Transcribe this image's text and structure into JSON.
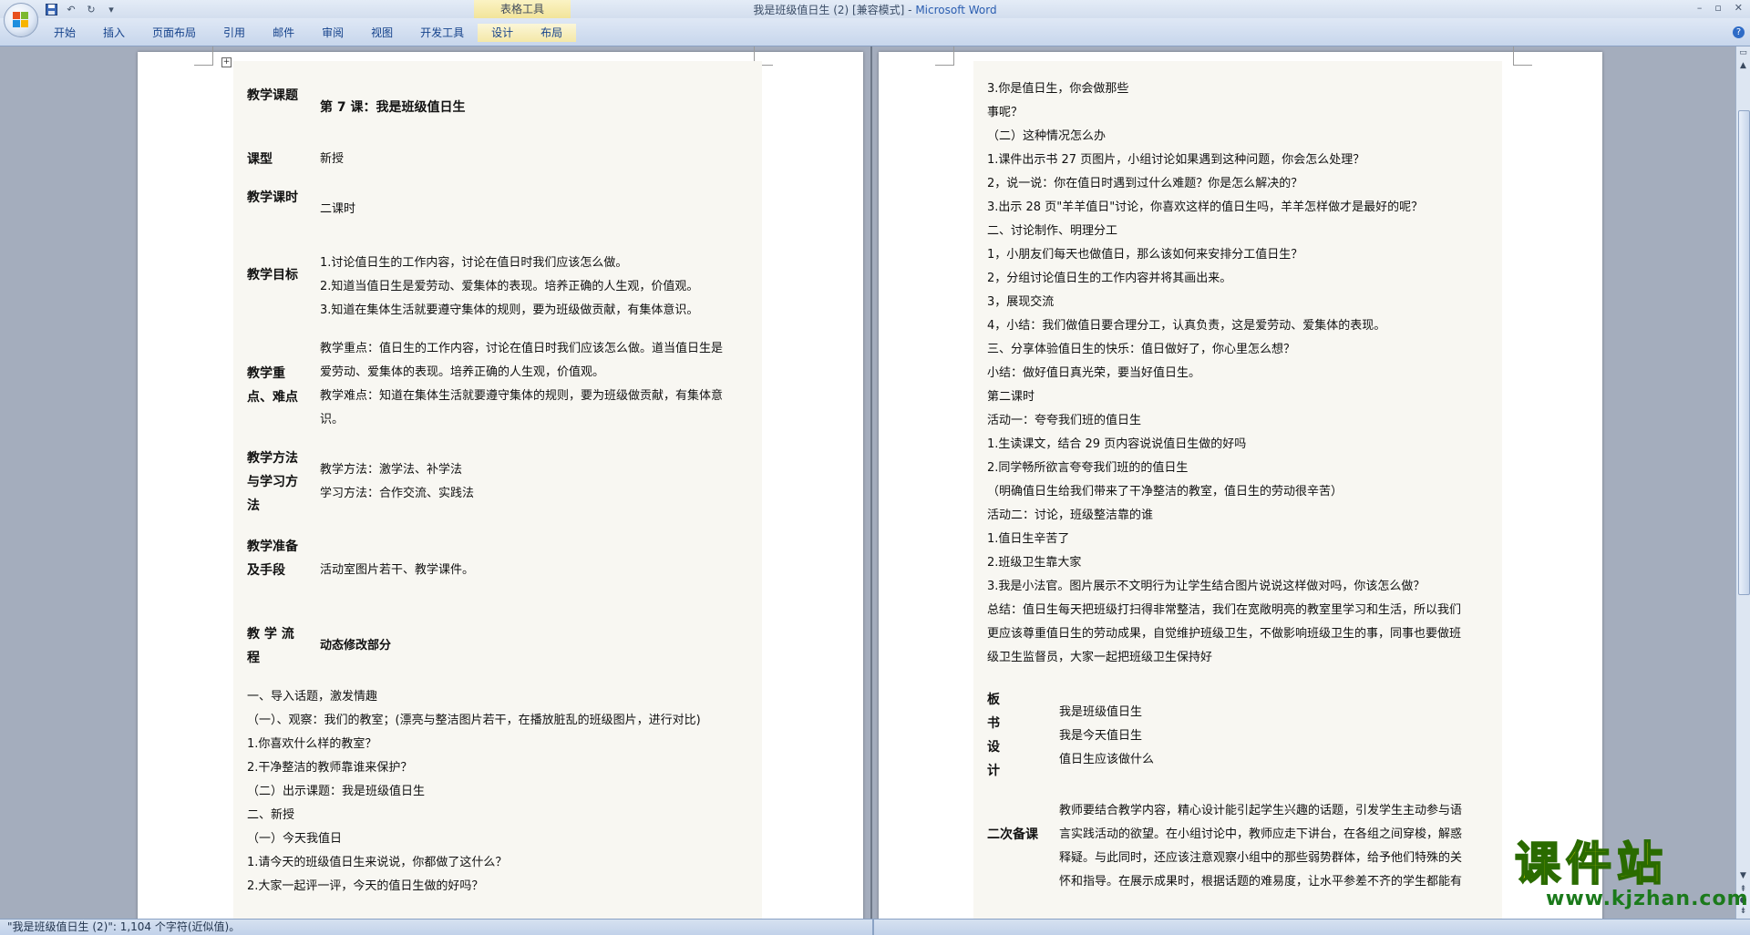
{
  "window": {
    "title": "我是班级值日生 (2) [兼容模式] - ",
    "app": "Microsoft Word",
    "context_tools": "表格工具"
  },
  "ribbon": {
    "tabs": [
      "开始",
      "插入",
      "页面布局",
      "引用",
      "邮件",
      "审阅",
      "视图",
      "开发工具",
      "设计",
      "布局"
    ]
  },
  "left_page": {
    "table": [
      {
        "label": "教学课题",
        "content": [
          "第 7 课：我是班级值日生"
        ],
        "bold": true
      },
      {
        "label": "课型",
        "content": [
          "新授"
        ]
      },
      {
        "label": "教学课时",
        "content": [
          "二课时"
        ]
      },
      {
        "label": "教学目标",
        "content": [
          "1.讨论值日生的工作内容，讨论在值日时我们应该怎么做。",
          "2.知道当值日生是爱劳动、爱集体的表现。培养正确的人生观，价值观。",
          "3.知道在集体生活就要遵守集体的规则，要为班级做贡献，有集体意识。"
        ]
      },
      {
        "label": "教学重点、难点",
        "content": [
          "教学重点：值日生的工作内容，讨论在值日时我们应该怎么做。道当值日生是",
          "爱劳动、爱集体的表现。培养正确的人生观，价值观。",
          "教学难点：知道在集体生活就要遵守集体的规则，要为班级做贡献，有集体意",
          "识。"
        ]
      },
      {
        "label": "教学方法与学习方法",
        "content": [
          "教学方法：激学法、补学法",
          "学习方法：合作交流、实践法"
        ]
      },
      {
        "label": "教学准备及手段",
        "content": [
          "活动室图片若干、教学课件。"
        ]
      },
      {
        "label": "教 学 流 程",
        "content": [
          "动态修改部分"
        ],
        "bold": true
      }
    ],
    "body": [
      "一、导入话题，激发情趣",
      "（一）、观察：我们的教室；(漂亮与整洁图片若干，在播放脏乱的班级图片，进行对比)",
      "1.你喜欢什么样的教室？",
      "2.干净整洁的教师靠谁来保护？",
      "（二）出示课题：我是班级值日生",
      "二、新授",
      "（一）今天我值日",
      "1.请今天的班级值日生来说说，你都做了这什么？",
      "2.大家一起评一评，今天的值日生做的好吗？"
    ]
  },
  "right_page": {
    "body": [
      "3.你是值日生，你会做那些",
      "事呢？",
      "（二）这种情况怎么办",
      "1.课件出示书 27 页图片，小组讨论如果遇到这种问题，你会怎么处理？",
      "2，说一说：你在值日时遇到过什么难题？你是怎么解决的？",
      "3.出示 28 页\"羊羊值日\"讨论，你喜欢这样的值日生吗，羊羊怎样做才是最好的呢？",
      "二、讨论制作、明理分工",
      "1，小朋友们每天也做值日，那么该如何来安排分工值日生？",
      "2，分组讨论值日生的工作内容并将其画出来。",
      "3，展现交流",
      "4，小结：我们做值日要合理分工，认真负责，这是爱劳动、爱集体的表现。",
      "三、分享体验值日生的快乐：值日做好了，你心里怎么想？",
      "小结：做好值日真光荣，要当好值日生。",
      "第二课时",
      "活动一：夸夸我们班的值日生",
      "1.生读课文，结合 29 页内容说说值日生做的好吗",
      "2.同学畅所欲言夸夸我们班的的值日生",
      "（明确值日生给我们带来了干净整洁的教室，值日生的劳动很辛苦）",
      "活动二：讨论，班级整洁靠的谁",
      "1.值日生辛苦了",
      "2.班级卫生靠大家",
      "3.我是小法官。图片展示不文明行为让学生结合图片说说这样做对吗，你该怎么做？",
      "总结：值日生每天把班级打扫得非常整洁，我们在宽敞明亮的教室里学习和生活，所以我们",
      "更应该尊重值日生的劳动成果，自觉维护班级卫生，不做影响班级卫生的事，同事也要做班",
      "级卫生监督员，大家一起把班级卫生保持好"
    ],
    "board_label": [
      "板",
      "书",
      "设",
      "计"
    ],
    "board_lines": [
      "我是班级值日生",
      "我是今天值日生",
      "值日生应该做什么"
    ],
    "prep2_label": "二次备课",
    "prep2_text": [
      "教师要结合教学内容，精心设计能引起学生兴趣的话题，引发学生主动参与语",
      "言实践活动的欲望。在小组讨论中，教师应走下讲台，在各组之间穿梭，解惑",
      "释疑。与此同时，还应该注意观察小组中的那些弱势群体，给予他们特殊的关",
      "怀和指导。在展示成果时，根据话题的难易度，让水平参差不齐的学生都能有"
    ]
  },
  "watermark": {
    "cn": "课件站",
    "url": "www.kjzhan.com"
  },
  "status": {
    "text": "\"我是班级值日生 (2)\": 1,104 个字符(近似值)。"
  },
  "colors": {
    "accent": "#15428b",
    "ribbon": "#c7d6ec",
    "shade": "#f8f7f2"
  }
}
